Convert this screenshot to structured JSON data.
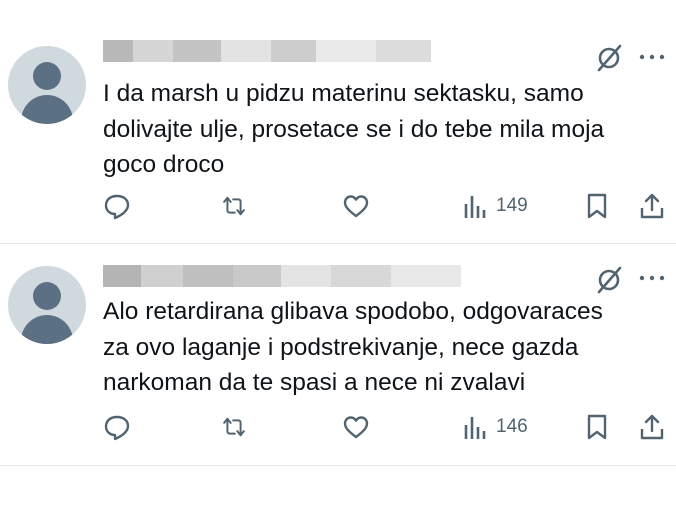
{
  "tweets": [
    {
      "author_redacted": true,
      "text": "I da marsh u pidzu materinu sektasku, samo\ndolivajte ulje, prosetace se i do tebe mila moja\ngoco droco",
      "views": "149"
    },
    {
      "author_redacted": true,
      "text": "Alo retardirana glibava spodobo, odgovaraces\nza ovo laganje i podstrekivanje, nece gazda\nnarkoman da te spasi a nece ni zvalavi",
      "views": "146"
    }
  ],
  "icons": {
    "reply": "reply-icon",
    "retweet": "retweet-icon",
    "like": "like-icon",
    "views": "views-icon",
    "bookmark": "bookmark-icon",
    "share": "share-icon",
    "grok": "grok-icon",
    "more": "more-icon"
  },
  "colors": {
    "icon": "#536471",
    "text": "#0f1419",
    "avatar_bg": "#cfd9de",
    "avatar_fg": "#5b7083"
  }
}
